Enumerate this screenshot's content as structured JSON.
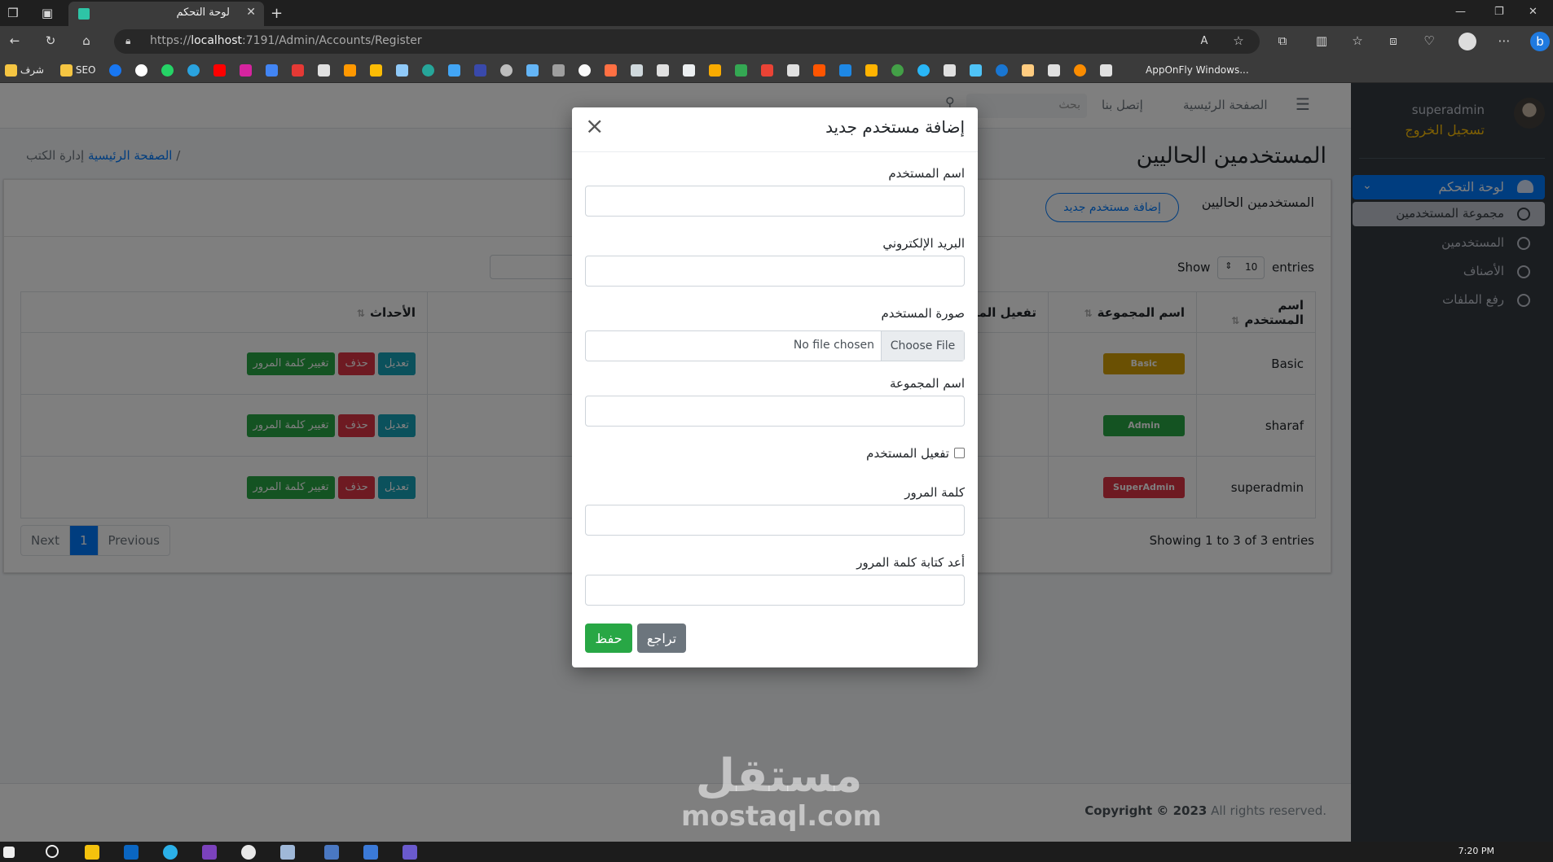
{
  "browser": {
    "tab_title": "لوحة التحكم",
    "url_prefix": "https://",
    "url_host": "localhost",
    "url_path": ":7191/Admin/Accounts/Register",
    "bookmarks": [
      {
        "label": "شرف",
        "color": "#f5c542"
      },
      {
        "label": "SEO",
        "color": "#f5c542"
      },
      {
        "label": "AppOnFly Windows...",
        "color": "#ffffff"
      }
    ]
  },
  "sidebar": {
    "user_name": "superadmin",
    "logout": "تسجيل الخروج",
    "items": [
      {
        "label": "لوحة التحكم"
      },
      {
        "label": "مجموعة المستخدمين"
      },
      {
        "label": "المستخدمين"
      },
      {
        "label": "الأصناف"
      },
      {
        "label": "رفع الملفات"
      }
    ]
  },
  "topnav": {
    "home": "الصفحة الرئيسية",
    "contact": "إتصل بنا",
    "search_placeholder": "بحث"
  },
  "page": {
    "title": "المستخدمين الحاليين",
    "breadcrumb_home": "الصفحة الرئيسية",
    "breadcrumb_current": "إدارة الكتب",
    "breadcrumb_sep": "/"
  },
  "card": {
    "title": "المستخدمين الحاليين",
    "add_button": "إضافة مستخدم جديد",
    "show_label": "Show",
    "entries_label": "entries",
    "page_size": "10",
    "columns": [
      "اسم المستخدم",
      "اسم المجموعة",
      "تفعيل المستخدم",
      "الأحداث"
    ],
    "rows": [
      {
        "user": "Basic",
        "group": "Basic",
        "group_color": "#d4a106"
      },
      {
        "user": "sharaf",
        "group": "Admin",
        "group_color": "#28a745"
      },
      {
        "user": "superadmin",
        "group": "SuperAdmin",
        "group_color": "#dc3545"
      }
    ],
    "actions": {
      "edit": "تعديل",
      "delete": "حذف",
      "change_password": "تغيير كلمة المرور"
    },
    "info": "Showing 1 to 3 of 3 entries",
    "pagination": {
      "next": "Next",
      "current": "1",
      "previous": "Previous"
    }
  },
  "footer": {
    "copyright": "Copyright © 2023",
    "rights": " All rights reserved."
  },
  "watermark": {
    "arabic": "مستقل",
    "latin": "mostaql.com"
  },
  "modal": {
    "title": "إضافة مستخدم جديد",
    "username_label": "اسم المستخدم",
    "email_label": "البريد الإلكتروني",
    "image_label": "صورة المستخدم",
    "file_button": "Choose File",
    "file_status": "No file chosen",
    "group_label": "اسم المجموعة",
    "active_label": "تفعيل المستخدم",
    "password_label": "كلمة المرور",
    "confirm_password_label": "أعد كتابة كلمة المرور",
    "save": "حفظ",
    "back": "تراجع"
  },
  "taskbar": {
    "clock": "7:20 PM"
  }
}
